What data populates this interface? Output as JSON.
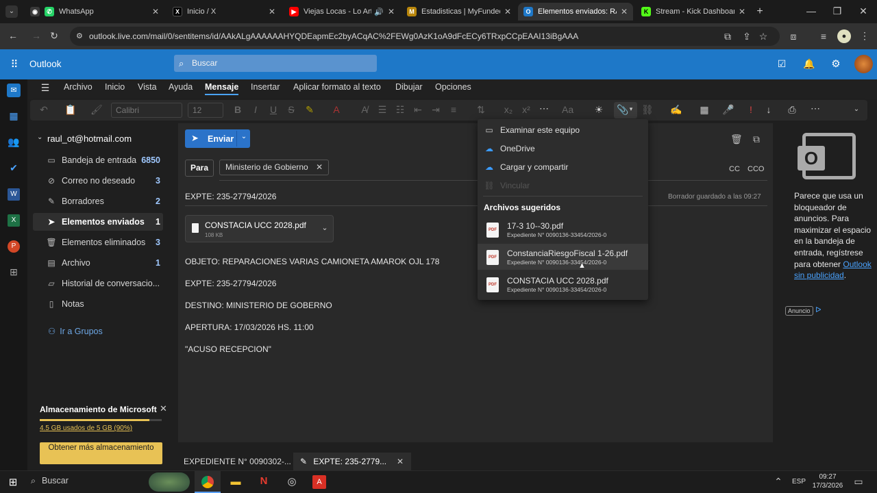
{
  "browser": {
    "tabs": [
      {
        "title": "WhatsApp",
        "icon": "whatsapp-icon",
        "color": "#25d366"
      },
      {
        "title": "Inicio / X",
        "icon": "x-icon",
        "color": "#000000"
      },
      {
        "title": "Viejas Locas - Lo Arte",
        "icon": "youtube-icon",
        "color": "#ff0000"
      },
      {
        "title": "Estadisticas | MyFundedF",
        "icon": "myfunded-icon",
        "color": "#b8860b"
      },
      {
        "title": "Elementos enviados: RAU",
        "icon": "outlook-icon",
        "color": "#1e78c8"
      },
      {
        "title": "Stream - Kick Dashboard",
        "icon": "kick-icon",
        "color": "#53fc18"
      }
    ],
    "url": "outlook.live.com/mail/0/sentitems/id/AAkALgAAAAAAHYQDEapmEc2byACqAC%2FEWg0AzK1oA9dFcECy6TRxpCCpEAAI13iBgAAA"
  },
  "outlook": {
    "app_name": "Outlook",
    "search_placeholder": "Buscar",
    "menu": [
      "Archivo",
      "Inicio",
      "Vista",
      "Ayuda",
      "Mensaje",
      "Insertar",
      "Aplicar formato al texto",
      "Dibujar",
      "Opciones"
    ],
    "active_menu": "Mensaje",
    "font_name": "Calibri",
    "font_size": "12"
  },
  "folders": {
    "account": "raul_ot@hotmail.com",
    "items": [
      {
        "label": "Bandeja de entrada",
        "count": "6850",
        "icon": "inbox-icon"
      },
      {
        "label": "Correo no deseado",
        "count": "3",
        "icon": "junk-icon"
      },
      {
        "label": "Borradores",
        "count": "2",
        "icon": "drafts-icon"
      },
      {
        "label": "Elementos enviados",
        "count": "1",
        "icon": "send-icon"
      },
      {
        "label": "Elementos eliminados",
        "count": "3",
        "icon": "trash-icon"
      },
      {
        "label": "Archivo",
        "count": "1",
        "icon": "archive-icon"
      },
      {
        "label": "Historial de conversacio...",
        "count": "",
        "icon": "folder-icon"
      },
      {
        "label": "Notas",
        "count": "",
        "icon": "notes-icon"
      }
    ],
    "groups_link": "Ir a Grupos"
  },
  "storage": {
    "title": "Almacenamiento de Microsoft",
    "usage": "4.5 GB usados de 5 GB (90%)",
    "used_fraction": 0.9,
    "button": "Obtener más almacenamiento"
  },
  "compose": {
    "send_label": "Enviar",
    "to_label": "Para",
    "recipient": "Ministerio de Gobierno",
    "cc": "CC",
    "cco": "CCO",
    "subject": "EXPTE: 235-27794/2026",
    "draft_status": "Borrador guardado a las 09:27",
    "attachment": {
      "name": "CONSTACIA UCC 2028.pdf",
      "size": "108 KB"
    },
    "body": [
      "OBJETO: REPARACIONES VARIAS CAMIONETA AMAROK OJL 178",
      "EXPTE: 235-27794/2026",
      "DESTINO: MINISTERIO DE GOBERNO",
      "APERTURA: 17/03/2026 HS. 11:00",
      "\"ACUSO RECEPCION\""
    ]
  },
  "attach_menu": {
    "items": [
      {
        "label": "Examinar este equipo",
        "icon": "computer-icon"
      },
      {
        "label": "OneDrive",
        "icon": "onedrive-icon"
      },
      {
        "label": "Cargar y compartir",
        "icon": "cloud-upload-icon"
      },
      {
        "label": "Vincular",
        "icon": "link-icon"
      }
    ],
    "suggested_title": "Archivos sugeridos",
    "suggested": [
      {
        "name": "17-3 10--30.pdf",
        "path": "Expediente N° 0090136-33454/2026-0"
      },
      {
        "name": "ConstanciaRiesgoFiscal 1-26.pdf",
        "path": "Expediente N° 0090136-33454/2026-0"
      },
      {
        "name": "CONSTACIA UCC 2028.pdf",
        "path": "Expediente N° 0090136-33454/2026-0"
      }
    ]
  },
  "ad": {
    "text": "Parece que usa un bloqueador de anuncios. Para maximizar el espacio en la bandeja de entrada, regístrese para obtener",
    "link": "Outlook sin publicidad",
    "badge": "Anuncio"
  },
  "drafts_strip": {
    "item1": "EXPEDIENTE N° 0090302-...",
    "item2": "EXPTE: 235-2779..."
  },
  "taskbar": {
    "search": "Buscar",
    "lang": "ESP",
    "time": "09:27",
    "date": "17/3/2026"
  }
}
